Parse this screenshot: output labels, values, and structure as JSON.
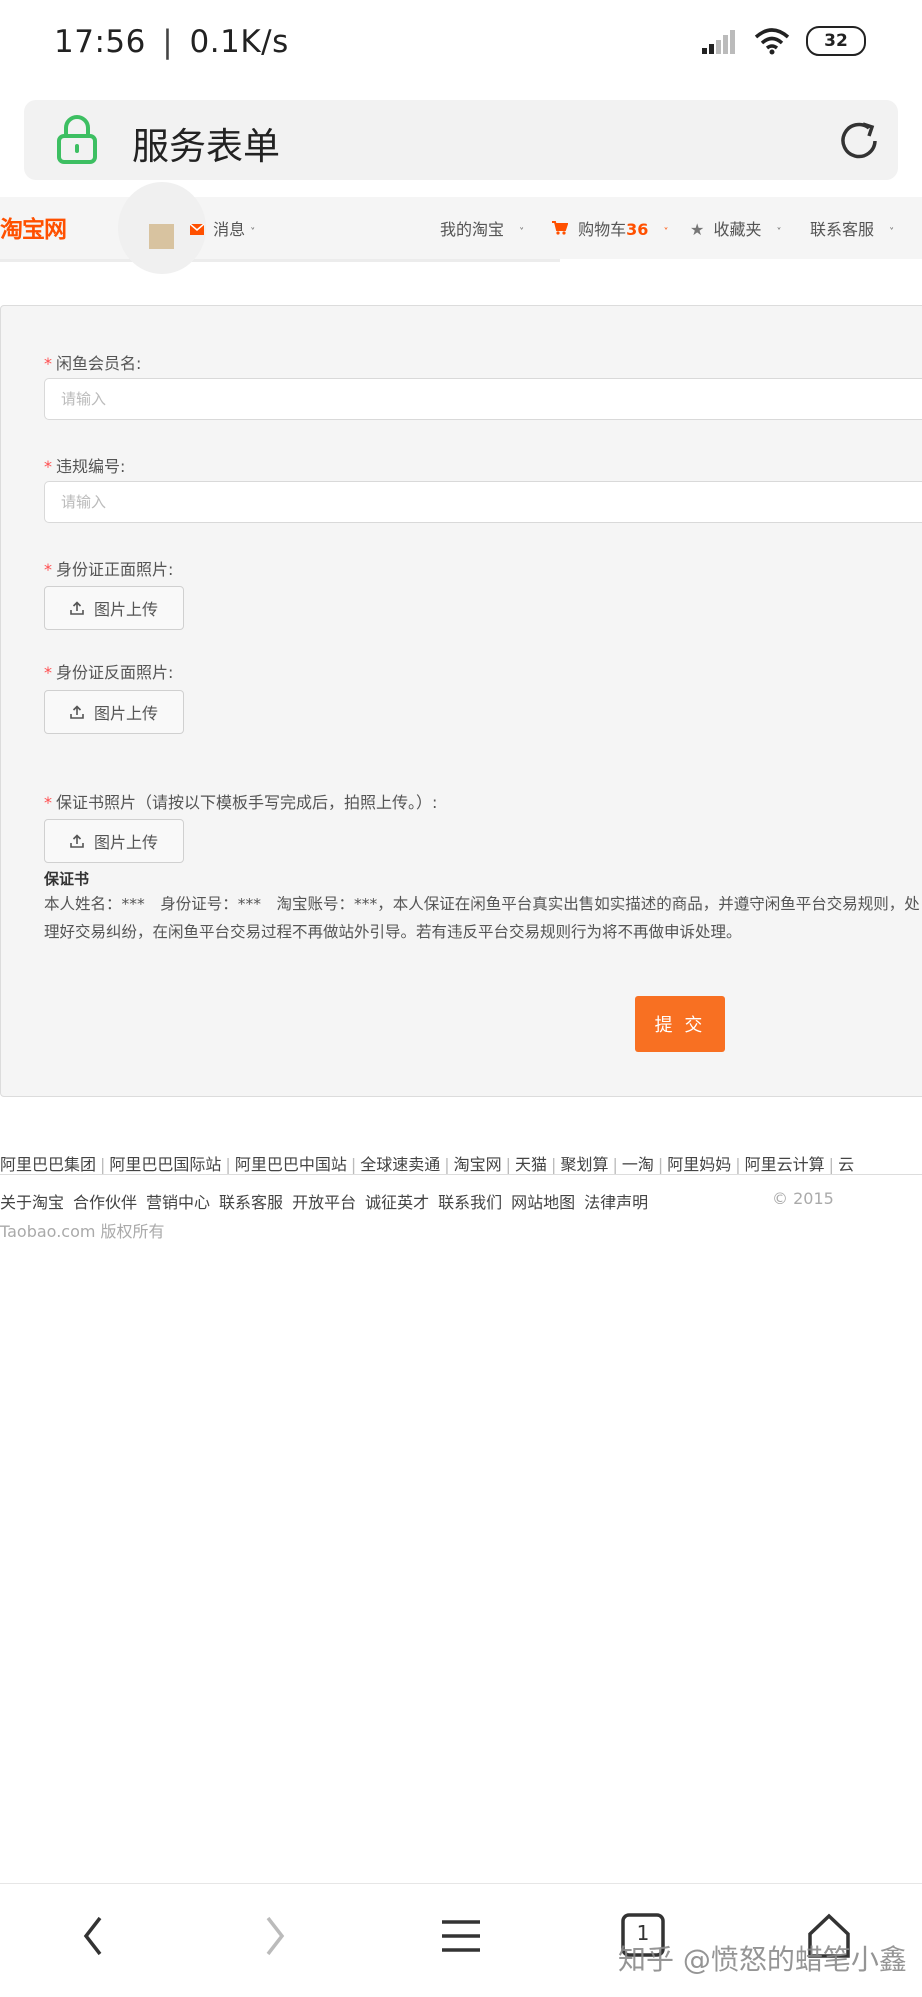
{
  "status_bar": {
    "time": "17:56",
    "speed": "0.1K/s",
    "battery": "32"
  },
  "browser": {
    "page_title": "服务表单"
  },
  "taobao_header": {
    "logo": "淘宝网",
    "messages": "消息",
    "my_taobao": "我的淘宝",
    "cart_label": "购物车",
    "cart_count": "36",
    "favorites": "收藏夹",
    "customer_service": "联系客服"
  },
  "form": {
    "member_name_label": "闲鱼会员名:",
    "member_name_placeholder": "请输入",
    "violation_label": "违规编号:",
    "violation_placeholder": "请输入",
    "id_front_label": "身份证正面照片:",
    "id_back_label": "身份证反面照片:",
    "guarantee_photo_label": "保证书照片（请按以下模板手写完成后，拍照上传。）:",
    "upload_label": "图片上传",
    "guarantee_title": "保证书",
    "guarantee_text": "本人姓名：***　身份证号：***　淘宝账号：***，本人保证在闲鱼平台真实出售如实描述的商品，并遵守闲鱼平台交易规则，处理好交易纠纷，在闲鱼平台交易过程不再做站外引导。若有违反平台交易规则行为将不再做申诉处理。",
    "submit_label": "提 交"
  },
  "footer": {
    "group_links": [
      "阿里巴巴集团",
      "阿里巴巴国际站",
      "阿里巴巴中国站",
      "全球速卖通",
      "淘宝网",
      "天猫",
      "聚划算",
      "一淘",
      "阿里妈妈",
      "阿里云计算",
      "云"
    ],
    "links": [
      "关于淘宝",
      "合作伙伴",
      "营销中心",
      "联系客服",
      "开放平台",
      "诚征英才",
      "联系我们",
      "网站地图",
      "法律声明"
    ],
    "year": "© 2015",
    "copyright": "Taobao.com 版权所有"
  },
  "watermark": "知乎 @愤怒的蜡笔小鑫",
  "bottom_nav": {
    "tab_count": "1"
  },
  "colors": {
    "accent": "#f87022",
    "logo": "#ff5000",
    "required": "#ff4d4f",
    "lock": "#3dbf62"
  }
}
